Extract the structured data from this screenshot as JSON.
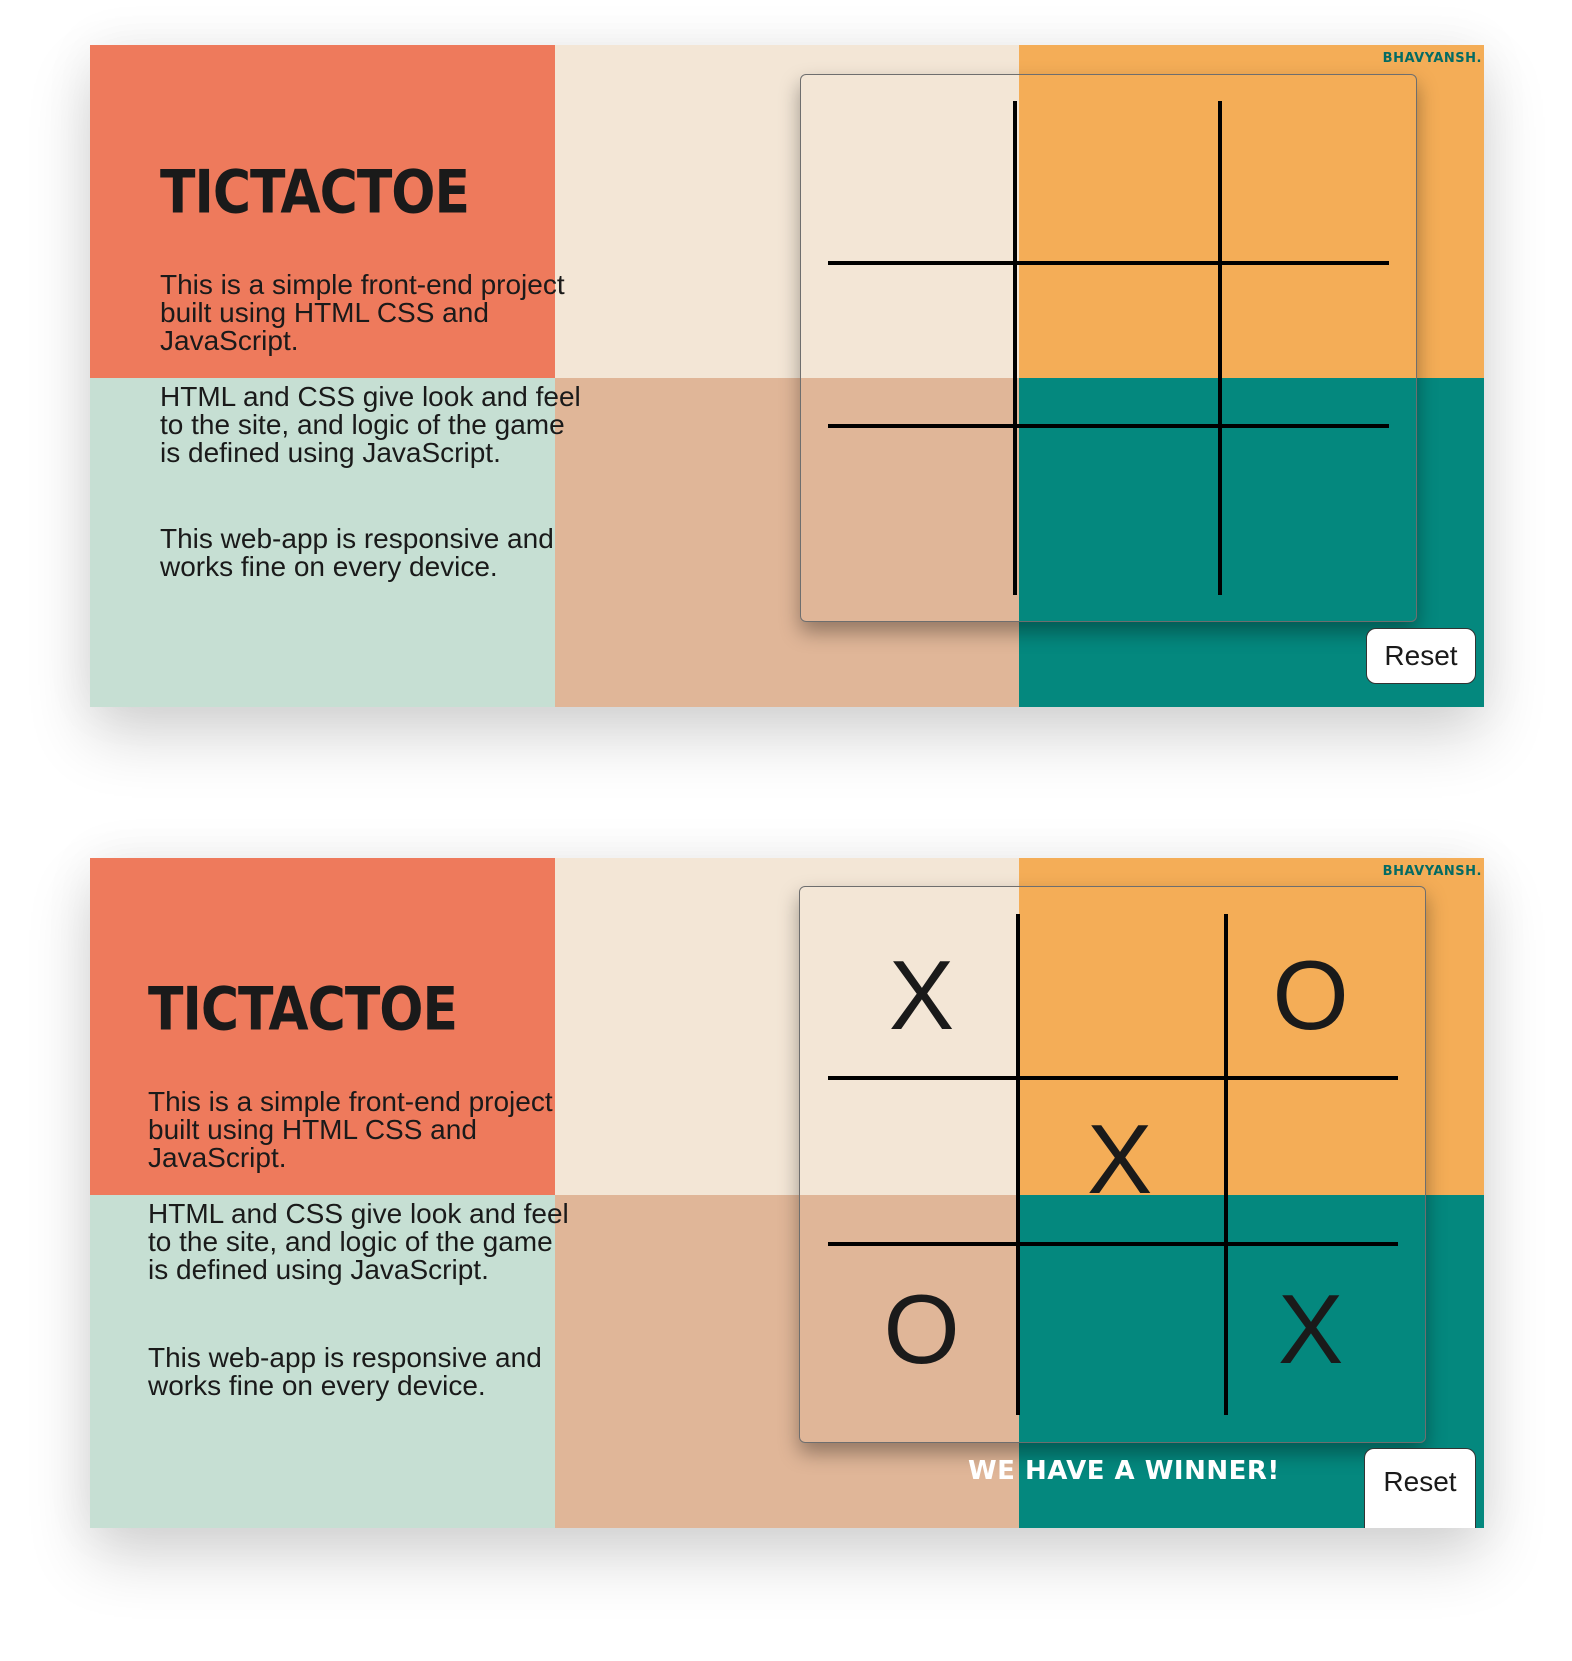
{
  "theme": {
    "coral": "#ee7a5c",
    "cream": "#f3e6d6",
    "orange": "#f4ad57",
    "mint": "#c6dfd3",
    "tan": "#e0b698",
    "teal": "#04887e",
    "text": "#1a1a1a",
    "brand": "#046b63"
  },
  "screens": [
    {
      "brand": "BHAVYANSH.",
      "title": "TICTACTOE",
      "paragraphs": [
        "This is a simple front-end project built using HTML CSS and JavaScript.",
        "HTML and CSS give look and feel to the site, and logic of the game is defined using JavaScript.",
        "This web-app is responsive and works fine on every device."
      ],
      "board": [
        "",
        "",
        "",
        "",
        "",
        "",
        "",
        "",
        ""
      ],
      "status": "",
      "reset_label": "Reset"
    },
    {
      "brand": "BHAVYANSH.",
      "title": "TICTACTOE",
      "paragraphs": [
        "This is a simple front-end project built using HTML CSS and JavaScript.",
        "HTML and CSS give look and feel to the site, and logic of the game is defined using JavaScript.",
        "This web-app is responsive and works fine on every device."
      ],
      "board": [
        "X",
        "",
        "O",
        "",
        "X",
        "",
        "O",
        "",
        "X"
      ],
      "status": "WE HAVE A WINNER!",
      "reset_label": "Reset"
    }
  ]
}
